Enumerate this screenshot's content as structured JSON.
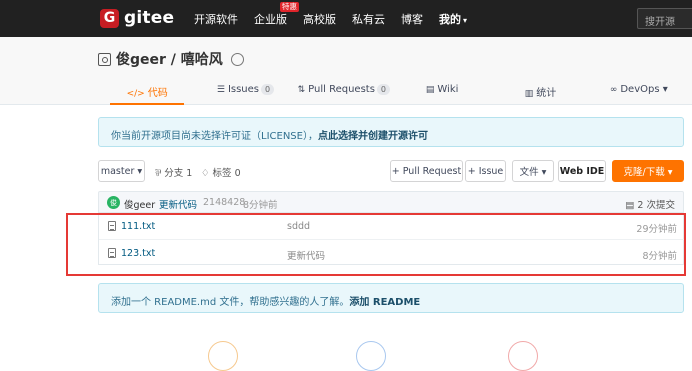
{
  "nav": {
    "logo_text": "gitee",
    "links": [
      "开源软件",
      "企业版",
      "高校版",
      "私有云",
      "博客",
      "我的"
    ],
    "hot_badge": "特惠",
    "search_placeholder": "搜开源"
  },
  "project": {
    "title": "俊geer / 嘻哈风",
    "tabs": [
      {
        "icon": "</>",
        "label": "代码",
        "count": ""
      },
      {
        "icon": "☰",
        "label": "Issues",
        "count": "0"
      },
      {
        "icon": "⇅",
        "label": "Pull Requests",
        "count": "0"
      },
      {
        "icon": "▤",
        "label": "Wiki",
        "count": ""
      },
      {
        "icon": "▥",
        "label": "统计",
        "count": ""
      },
      {
        "icon": "∞",
        "label": "DevOps ▾",
        "count": ""
      }
    ]
  },
  "notice": {
    "text": "你当前开源项目尚未选择许可证（LICENSE），",
    "link": "点此选择并创建开源许可"
  },
  "toolbar": {
    "branch": "master ▾",
    "branches": "分支 1",
    "tags": "标签 0",
    "pull_request": "+ Pull Request",
    "issue": "+ Issue",
    "file": "文件 ▾",
    "web_ide": "Web IDE",
    "clone": "克隆/下载 ▾"
  },
  "commit": {
    "avatar_letter": "俊",
    "user": "俊geer",
    "message": "更新代码",
    "hash": "2148428",
    "time": "8分钟前",
    "count": "2 次提交"
  },
  "files": [
    {
      "name": "111.txt",
      "message": "sddd",
      "time": "29分钟前"
    },
    {
      "name": "123.txt",
      "message": "更新代码",
      "time": "8分钟前"
    }
  ],
  "readme": {
    "text": "添加一个 README.md 文件，帮助感兴趣的人了解。",
    "link": "添加 README"
  },
  "colors": {
    "accent": "#fe7300",
    "highlight": "#e53935",
    "nav_bg": "#212121"
  }
}
